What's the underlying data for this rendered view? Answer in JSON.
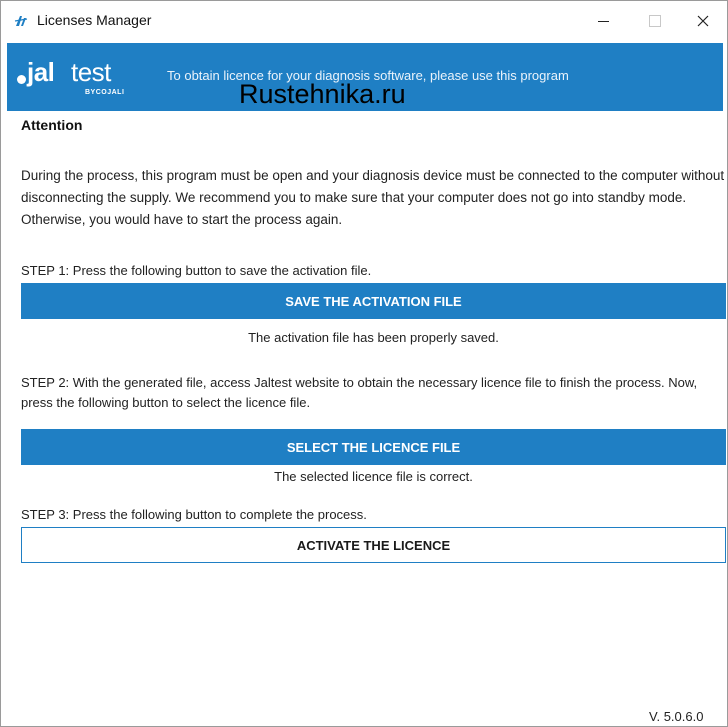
{
  "window": {
    "title": "Licenses Manager"
  },
  "banner": {
    "logo_main": "jal",
    "logo_second": "test",
    "logo_by": "BYCOJALI",
    "text": "To obtain licence for your diagnosis software, please use this program",
    "watermark": "Rustehnika.ru",
    "color": "#1f7fc4"
  },
  "content": {
    "attention_title": "Attention",
    "attention_text": "During the process, this program must be open and your diagnosis device must be connected to the computer without disconnecting the supply. We recommend you to make sure that your computer does not go into standby mode. Otherwise, you would have to start the process again.",
    "step1": {
      "text": "STEP 1: Press the following button to save the activation file.",
      "button_label": "SAVE THE ACTIVATION FILE",
      "status": "The activation file has been properly saved."
    },
    "step2": {
      "text": "STEP 2: With the generated file, access Jaltest website to obtain the necessary licence file to finish the process. Now, press the following button to select the licence file.",
      "button_label": "SELECT THE LICENCE FILE",
      "status": "The selected licence file is correct."
    },
    "step3": {
      "text": "STEP 3: Press the following button to complete the process.",
      "button_label": "ACTIVATE THE LICENCE"
    }
  },
  "footer": {
    "version": "V. 5.0.6.0"
  },
  "icons": {
    "app": "jaltest-app-icon",
    "minimize": "minimize-icon",
    "maximize": "maximize-icon",
    "close": "close-icon"
  }
}
